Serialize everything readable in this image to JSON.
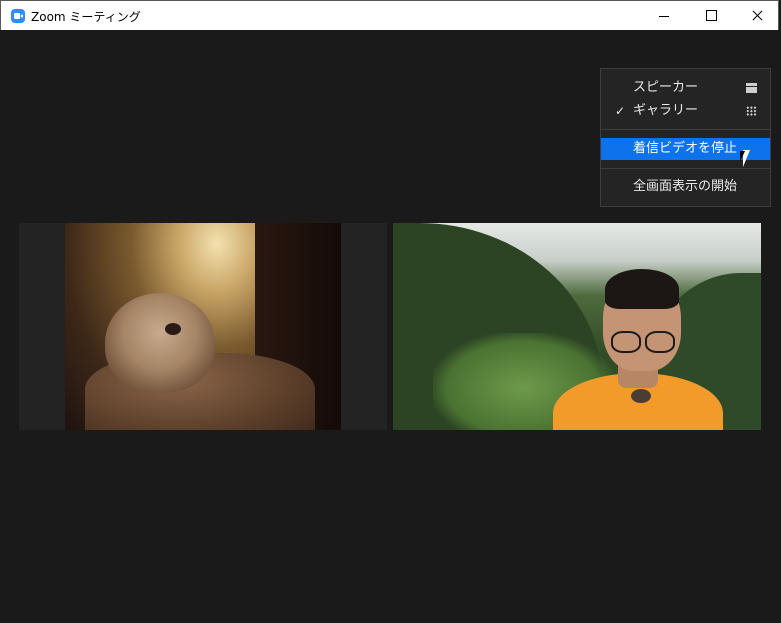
{
  "window": {
    "title": "Zoom ミーティング",
    "app_icon": "zoom-camera-icon",
    "controls": [
      "minimize-icon",
      "maximize-icon",
      "close-icon"
    ]
  },
  "view_menu": {
    "items": [
      {
        "label": "スピーカー",
        "checked": false,
        "icon": "speaker-view-icon"
      },
      {
        "label": "ギャラリー",
        "checked": true,
        "icon": "gallery-view-icon"
      },
      {
        "label": "着信ビデオを停止",
        "highlighted": true
      },
      {
        "label": "全画面表示の開始"
      }
    ],
    "check_glyph": "✓"
  },
  "participants": [
    {
      "tile": "left",
      "content": "teddy-bear-video"
    },
    {
      "tile": "right",
      "content": "man-with-glasses-video"
    }
  ],
  "colors": {
    "background": "#1a1a1a",
    "menu_bg": "#242424",
    "highlight": "#0e72ed",
    "zoom_blue": "#2d8cff"
  }
}
